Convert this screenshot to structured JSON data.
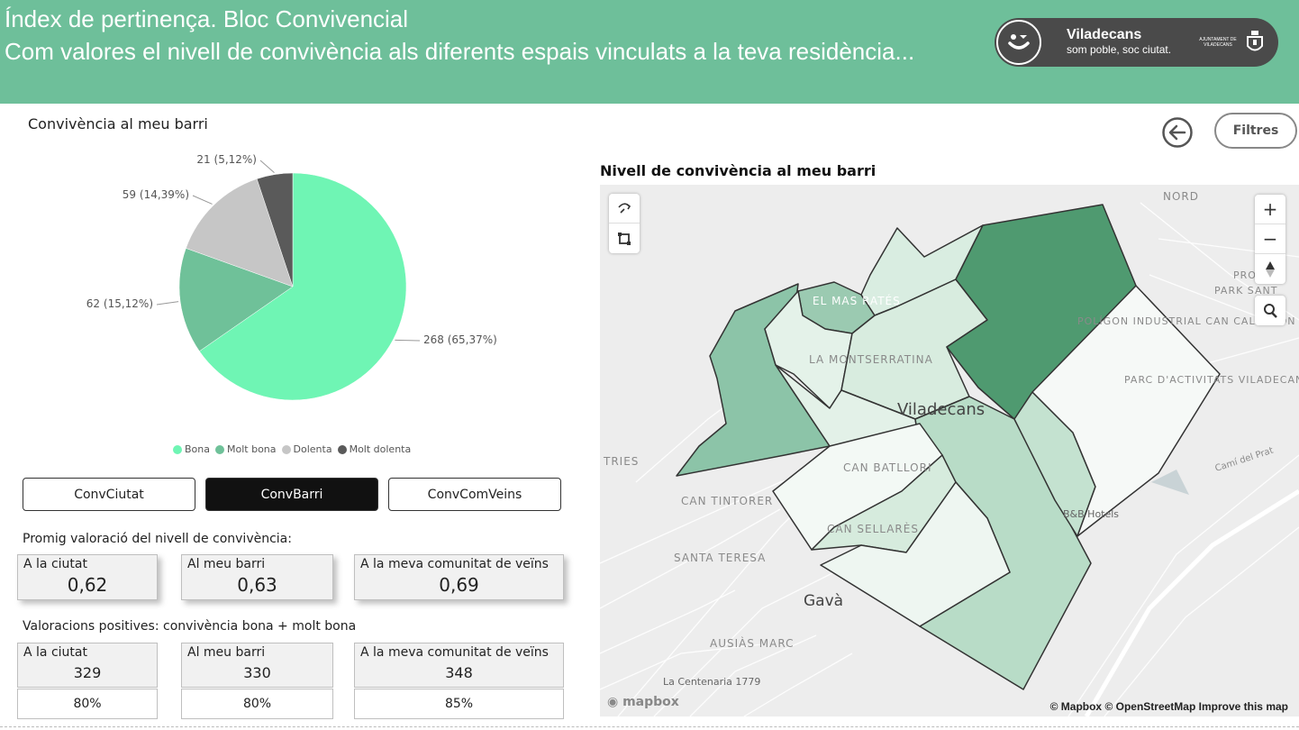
{
  "header": {
    "title": "Índex de pertinença. Bloc Convivencial",
    "subtitle": "Com valores el nivell de convivència als diferents espais vinculats a la teva residència...",
    "logo_name": "Viladecans",
    "logo_tagline": "som poble, soc ciutat.",
    "logo_ajuntament": "AJUNTAMENT DE VILADECANS",
    "bg_color": "#6ebf9a"
  },
  "pie_section": {
    "title": "Convivència al meu barri"
  },
  "chart_data": {
    "type": "pie",
    "slices": [
      {
        "name": "Bona",
        "value": 268,
        "label": "268 (65,37%)",
        "color": "#6ff5b4"
      },
      {
        "name": "Molt bona",
        "value": 62,
        "label": "62 (15,12%)",
        "color": "#6fc199"
      },
      {
        "name": "Dolenta",
        "value": 59,
        "label": "59 (14,39%)",
        "color": "#c6c6c6"
      },
      {
        "name": "Molt dolenta",
        "value": 21,
        "label": "21 (5,12%)",
        "color": "#5a5a5a"
      }
    ],
    "legend_position": "bottom"
  },
  "tabs": [
    {
      "label": "ConvCiutat",
      "active": false
    },
    {
      "label": "ConvBarri",
      "active": true
    },
    {
      "label": "ConvComVeins",
      "active": false
    }
  ],
  "averages": {
    "label": "Promig valoració del nivell de convivència:",
    "cards": [
      {
        "label": "A la ciutat",
        "value": "0,62"
      },
      {
        "label": "Al meu barri",
        "value": "0,63"
      },
      {
        "label": "A la meva comunitat de veïns",
        "value": "0,69"
      }
    ]
  },
  "positives": {
    "label": "Valoracions positives: convivència bona + molt bona",
    "cards": [
      {
        "label": "A la ciutat",
        "value": "329",
        "pct": "80%"
      },
      {
        "label": "Al meu barri",
        "value": "330",
        "pct": "80%"
      },
      {
        "label": "A la meva comunitat de veïns",
        "value": "348",
        "pct": "85%"
      }
    ]
  },
  "nav": {
    "filters_label": "Filtres"
  },
  "map": {
    "title": "Nivell de convivència al meu barri",
    "zoom_in": "+",
    "zoom_out": "−",
    "attribution": "© Mapbox © OpenStreetMap  Improve this map",
    "mapbox_logo": "mapbox",
    "place_labels": {
      "nord": "NORD",
      "mas_rates": "EL MAS RATÉS",
      "montserratina": "LA MONTSERRATINA",
      "viladecans": "Viladecans",
      "poligon": "POLÍGON INDUSTRIAL CAN CALDERON",
      "parc": "PARC D'ACTIVITATS VILADECANS",
      "park_sant": "PARK SANT",
      "pro": "PRO",
      "can_batllori": "CAN BATLLORI",
      "can_sellares": "CAN SELLARÈS",
      "can_tintorer": "CAN TINTORER",
      "santa_teresa": "SANTA TERESA",
      "gava": "Gavà",
      "ausias_marc": "AUSIÀS MARC",
      "centenaria": "La Centenaria 1779",
      "tries": "TRIES",
      "cami_prat": "Camí del Prat",
      "bb_hotels": "B&B Hotels"
    }
  }
}
